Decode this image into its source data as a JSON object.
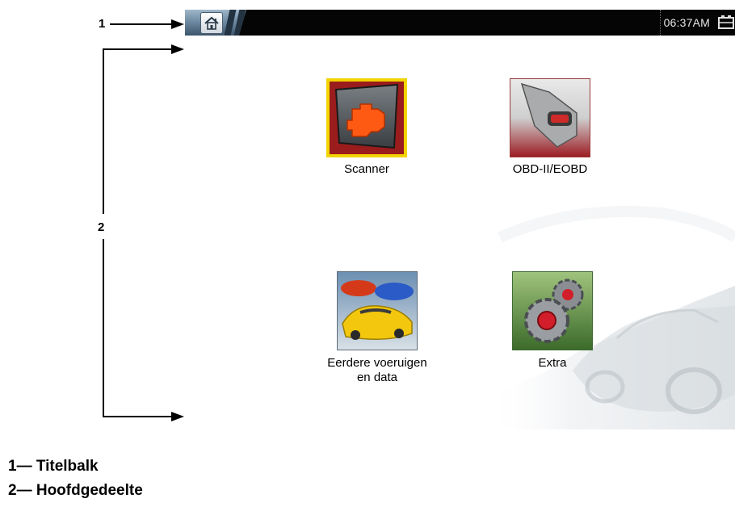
{
  "callouts": {
    "one": "1",
    "two": "2"
  },
  "titlebar": {
    "home_icon": "home-icon",
    "clock": "06:37AM",
    "battery_icon": "battery-icon"
  },
  "apps": [
    {
      "label": "Scanner",
      "icon": "engine-warning-icon",
      "selected": true
    },
    {
      "label": "OBD-II/EOBD",
      "icon": "obd-connector-icon",
      "selected": false
    },
    {
      "label_line1": "Eerdere voeruigen",
      "label_line2": "en data",
      "icon": "cars-icon",
      "selected": false
    },
    {
      "label": "Extra",
      "icon": "gears-icon",
      "selected": false
    }
  ],
  "legend": {
    "item1": "1— Titelbalk",
    "item2": "2— Hoofdgedeelte"
  },
  "colors": {
    "titlebar": "#050505",
    "selection_highlight": "#f2d400",
    "tile_red": "#c8102e",
    "tile_blue": "#1e4f8a",
    "tile_green": "#3c7a2a"
  }
}
